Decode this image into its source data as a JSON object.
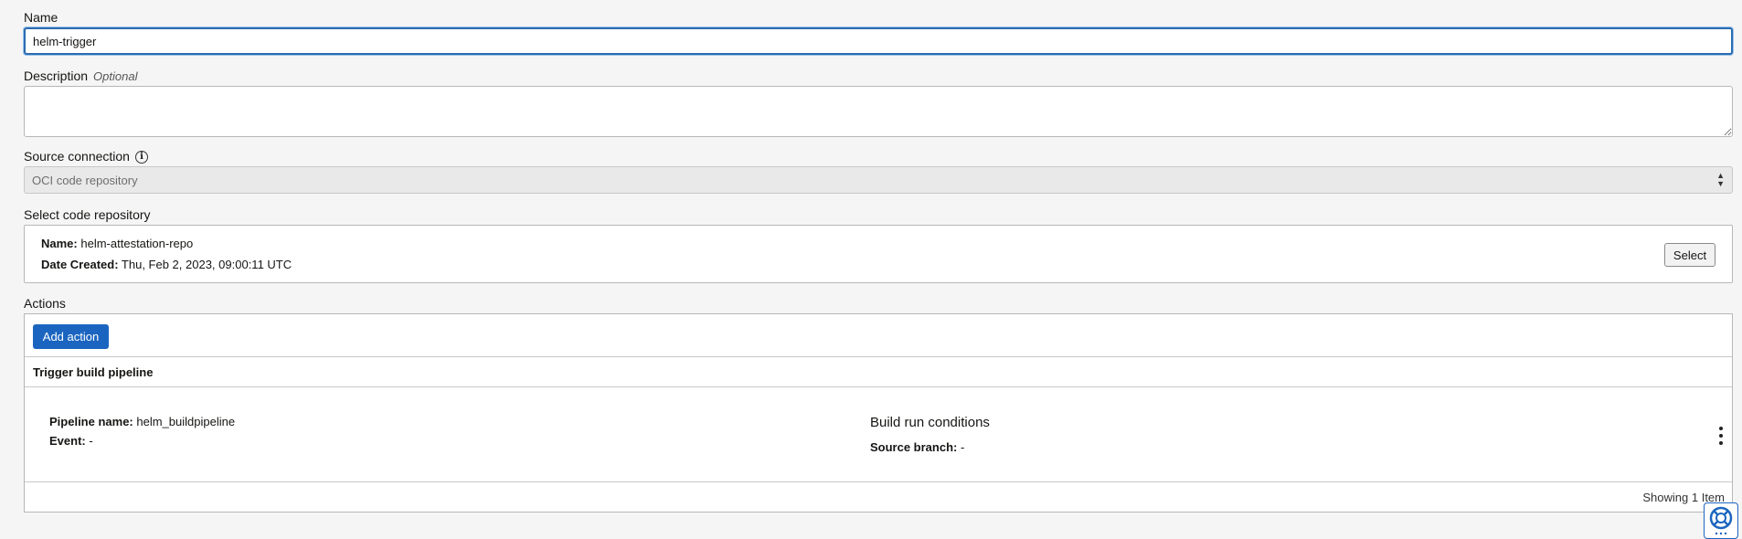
{
  "name_field": {
    "label": "Name",
    "value": "helm-trigger"
  },
  "description_field": {
    "label": "Description",
    "optional": "Optional",
    "value": ""
  },
  "source_connection": {
    "label": "Source connection",
    "info_icon": "info-icon",
    "selected": "OCI code repository"
  },
  "code_repository": {
    "label": "Select code repository",
    "name_label": "Name:",
    "name_value": "helm-attestation-repo",
    "date_label": "Date Created:",
    "date_value": "Thu, Feb 2, 2023, 09:00:11 UTC",
    "select_button": "Select"
  },
  "actions": {
    "label": "Actions",
    "add_button": "Add action",
    "section_title": "Trigger build pipeline",
    "pipeline_label": "Pipeline name:",
    "pipeline_value": "helm_buildpipeline",
    "event_label": "Event:",
    "event_value": "-",
    "conditions_title": "Build run conditions",
    "branch_label": "Source branch:",
    "branch_value": "-",
    "showing": "Showing 1 Item"
  },
  "colors": {
    "accent": "#1b65c0",
    "focus_border": "#2b6cb0",
    "background": "#f5f5f5"
  },
  "icons": {
    "help": "help-lifebuoy-icon",
    "more": "kebab-menu-icon",
    "select": "chevron-updown-icon"
  }
}
